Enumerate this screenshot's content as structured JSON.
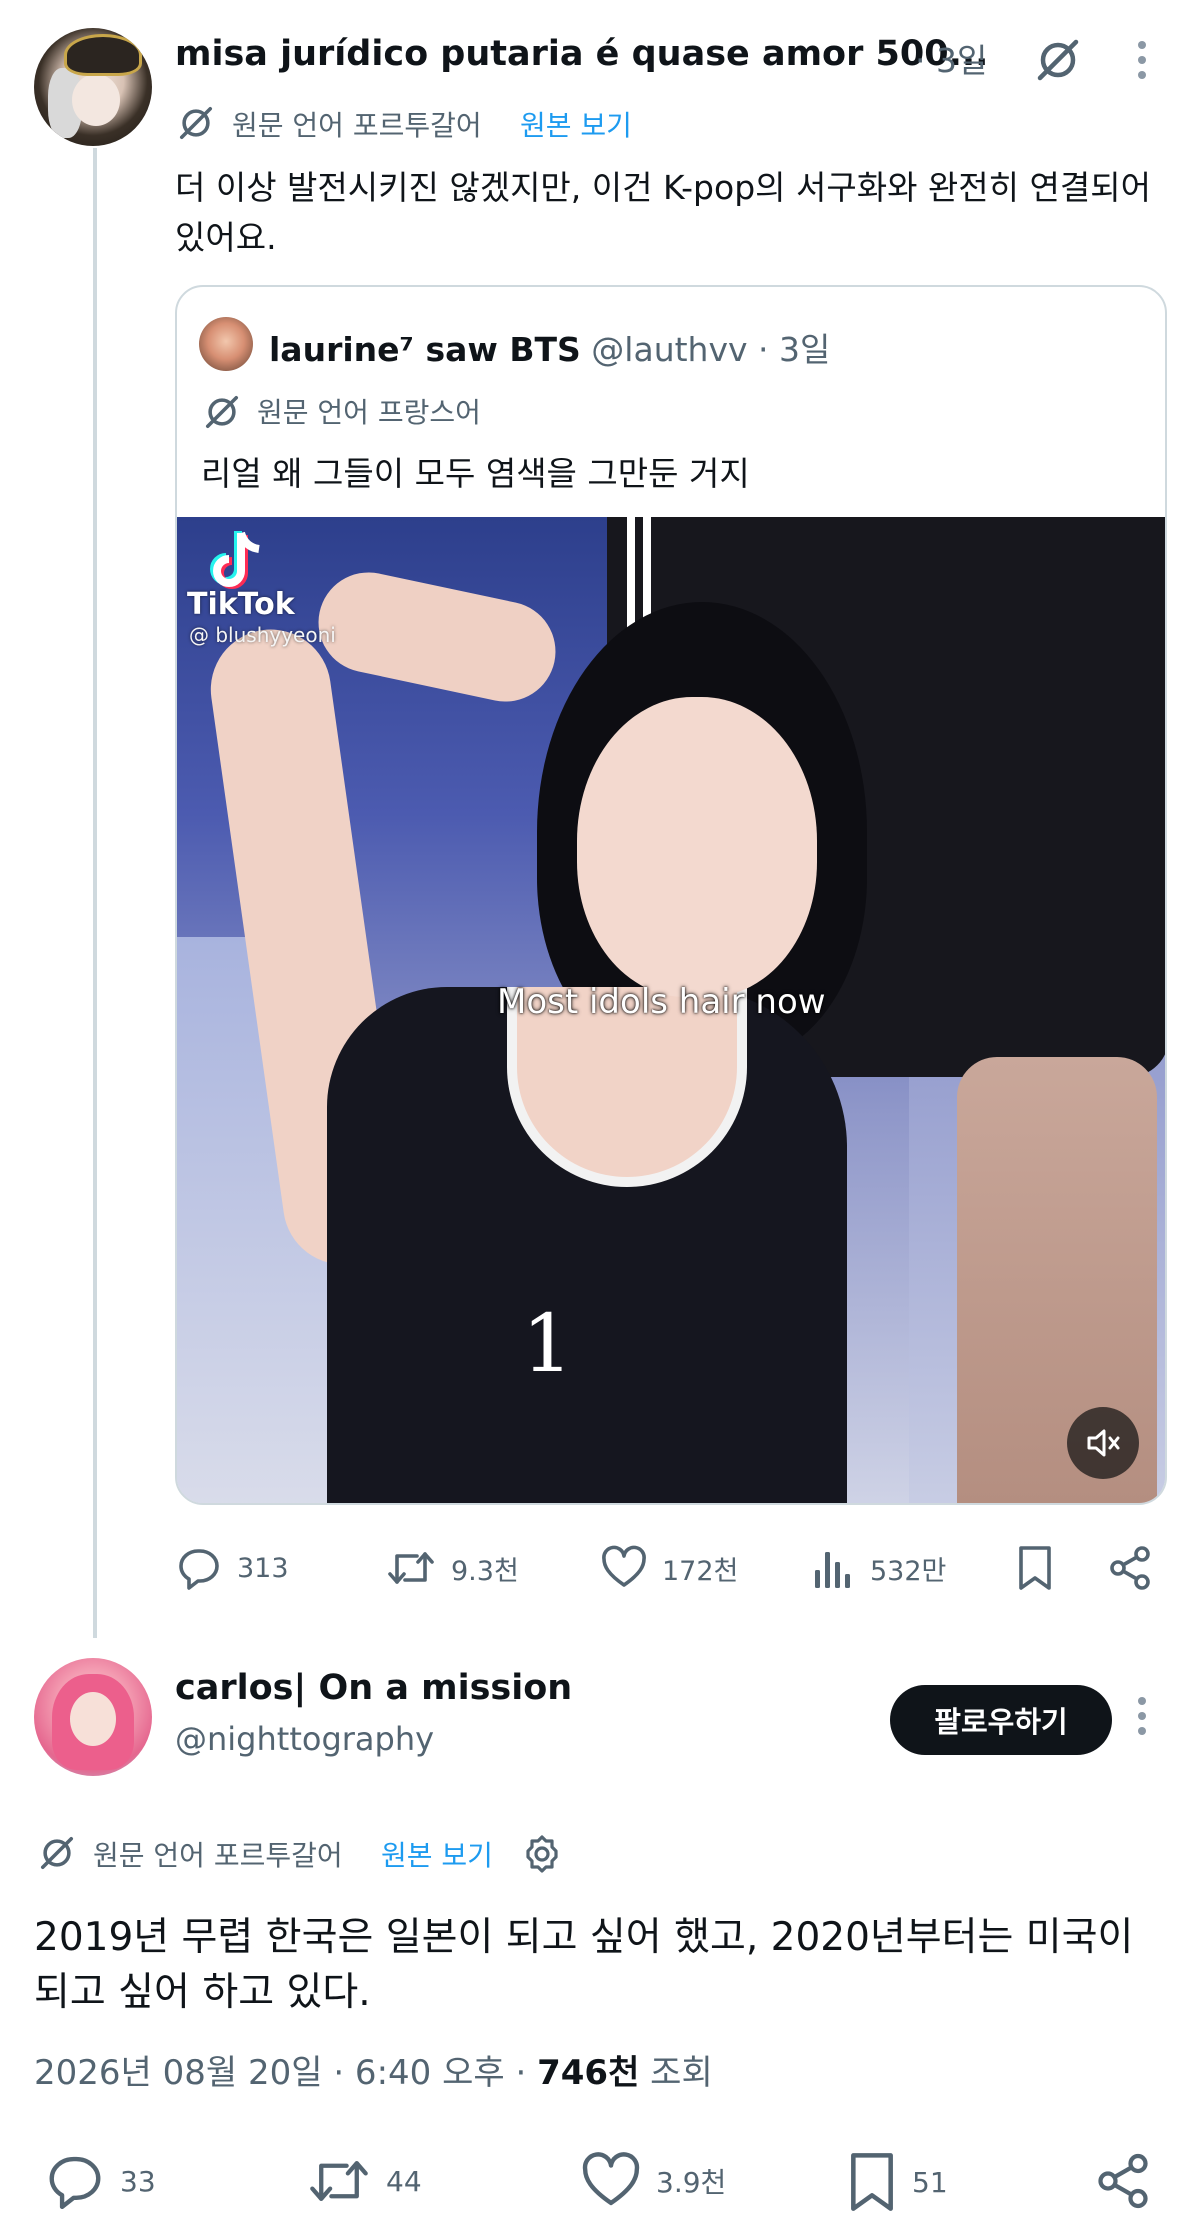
{
  "post1": {
    "author": "misa jurídico putaria é quase amor 500...",
    "time": "· 3일",
    "translation_note": "원문 언어 포르투갈어",
    "view_original": "원본 보기",
    "text": "더 이상 발전시키진 않겠지만, 이건 K-pop의 서구화와 완전히 연결되어 있어요.",
    "quote": {
      "author": "laurine⁷ saw BTS",
      "handle": "@lauthvv",
      "time": "· 3일",
      "translation_note": "원문 언어 프랑스어",
      "text": "리얼 왜 그들이 모두 염색을 그만둔 거지",
      "media": {
        "watermark_brand": "TikTok",
        "watermark_handle": "@ blushyyeoni",
        "caption": "Most idols hair now"
      }
    },
    "stats": {
      "replies": "313",
      "reposts": "9.3천",
      "likes": "172천",
      "views": "532만"
    }
  },
  "post2": {
    "author": "carlos| On a mission",
    "handle": "@nighttography",
    "follow_label": "팔로우하기",
    "translation_note": "원문 언어 포르투갈어",
    "view_original": "원본 보기",
    "text": "2019년 무렵 한국은 일본이 되고 싶어 했고, 2020년부터는 미국이 되고 싶어 하고 있다.",
    "date": "2026년 08월 20일 · 6:40 오후 ·",
    "views_count": "746천",
    "views_label": "조회",
    "stats": {
      "replies": "33",
      "reposts": "44",
      "likes": "3.9천",
      "bookmarks": "51"
    }
  },
  "colors": {
    "text": "#0f1419",
    "muted": "#536471",
    "link": "#1d9bf0",
    "border": "#cfd9de"
  }
}
